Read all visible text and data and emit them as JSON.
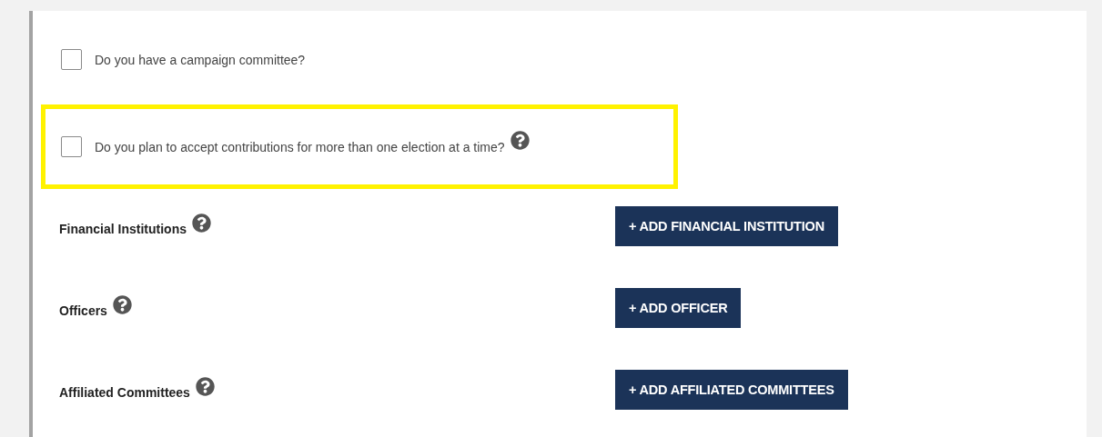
{
  "questions": [
    {
      "label": "Do you have a campaign committee?",
      "checked": false,
      "highlighted": false,
      "help": false
    },
    {
      "label": "Do you plan to accept contributions for more than one election at a time?",
      "checked": false,
      "highlighted": true,
      "help": true
    }
  ],
  "sections": [
    {
      "label": "Financial Institutions",
      "button": "+ ADD FINANCIAL INSTITUTION"
    },
    {
      "label": "Officers",
      "button": "+ ADD OFFICER"
    },
    {
      "label": "Affiliated Committees",
      "button": "+ ADD AFFILIATED COMMITTEES"
    }
  ]
}
